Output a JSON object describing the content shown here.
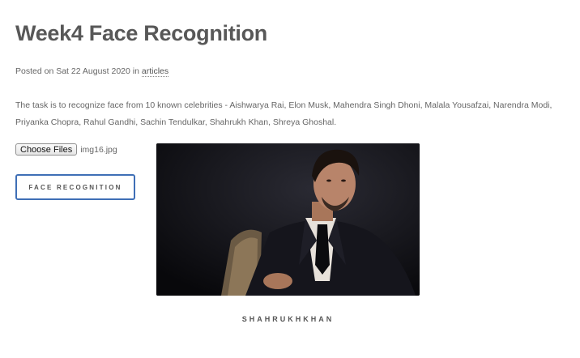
{
  "post": {
    "title": "Week4 Face Recognition",
    "posted_prefix": "Posted on Sat 22 August 2020 in ",
    "category": "articles",
    "description": "The task is to recognize face from 10 known celebrities - Aishwarya Rai, Elon Musk, Mahendra Singh Dhoni, Malala Yousafzai, Narendra Modi, Priyanka Chopra, Rahul Gandhi, Sachin Tendulkar, Shahrukh Khan, Shreya Ghoshal."
  },
  "upload": {
    "button_label": "Choose Files",
    "file_name": "img16.jpg"
  },
  "action": {
    "button_label": "FACE RECOGNITION"
  },
  "result": {
    "label": "SHAHRUKHKHAN"
  },
  "colors": {
    "button_border": "#3f6fb6",
    "text": "#555555"
  }
}
